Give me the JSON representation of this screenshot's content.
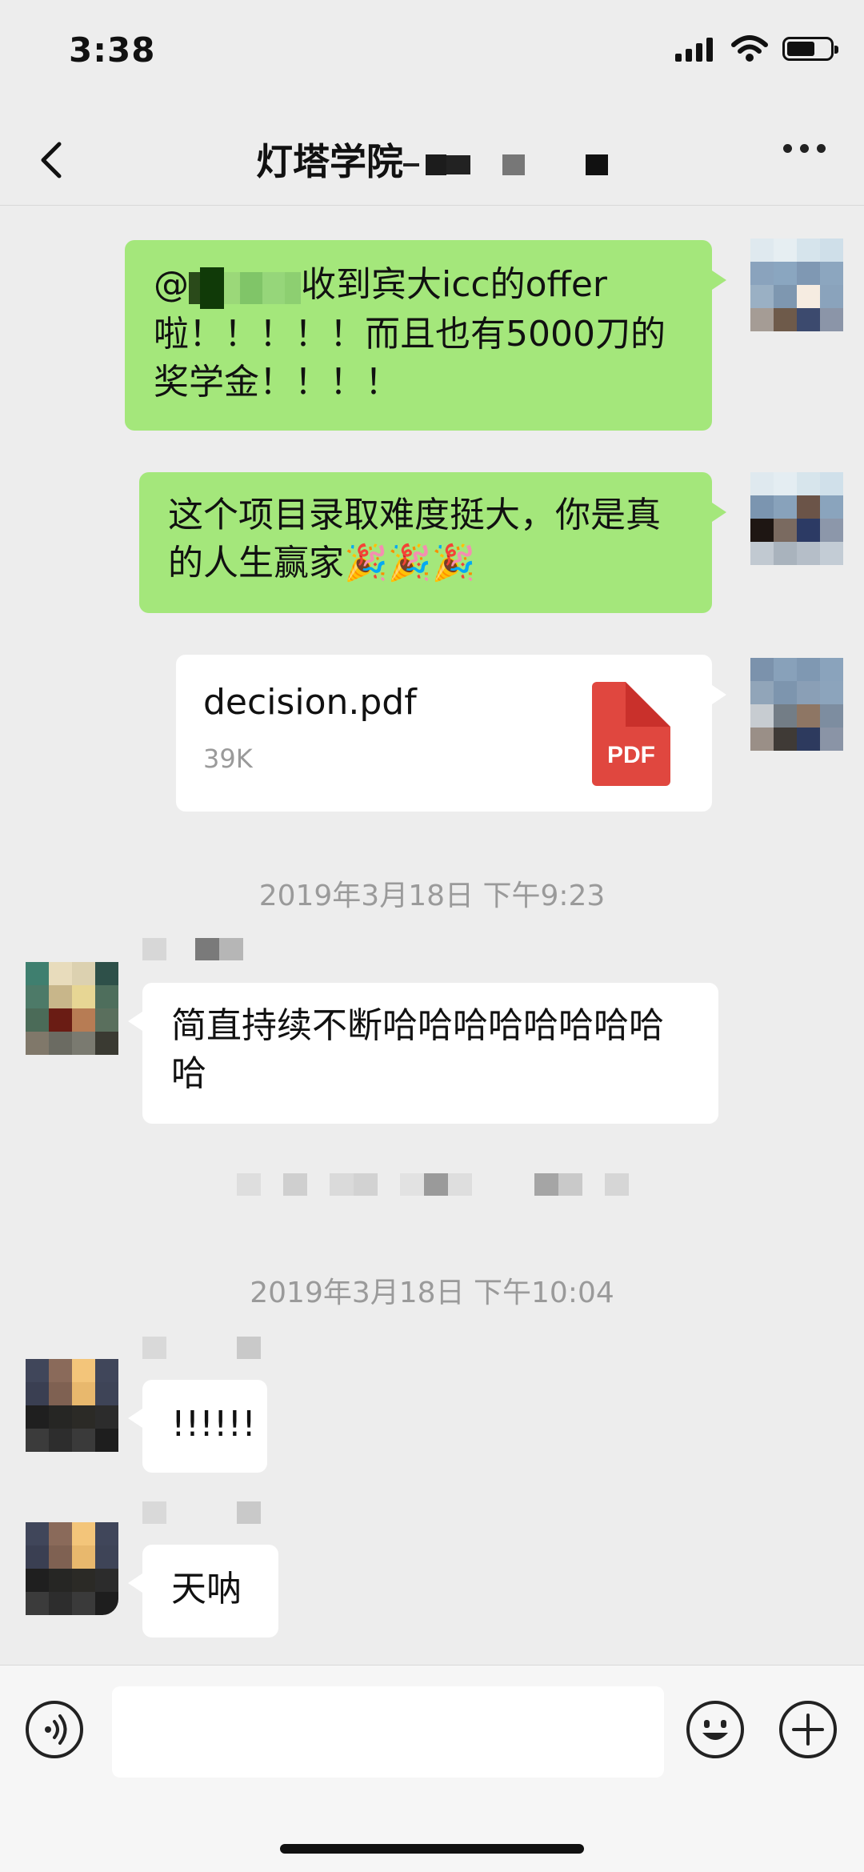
{
  "status_bar": {
    "time": "3:38"
  },
  "header": {
    "title": "灯塔学院"
  },
  "messages": [
    {
      "from": "me",
      "type": "text",
      "prefix": "@",
      "text": "收到宾大icc的offer啦！！！！！而且也有5000刀的奖学金！！！！"
    },
    {
      "from": "me",
      "type": "text",
      "text": "这个项目录取难度挺大，你是真的人生赢家🎉🎉🎉"
    },
    {
      "from": "me",
      "type": "file",
      "file_name": "decision.pdf",
      "file_size": "39K",
      "file_type_label": "PDF"
    },
    {
      "type": "timestamp",
      "text": "2019年3月18日 下午9:23"
    },
    {
      "from": "other",
      "type": "text",
      "text": "简直持续不断哈哈哈哈哈哈哈哈哈"
    },
    {
      "type": "timestamp",
      "text": "2019年3月18日 下午10:04"
    },
    {
      "from": "other",
      "type": "text",
      "text": "!!!!!!"
    },
    {
      "from": "other",
      "type": "text",
      "text": "天呐"
    }
  ],
  "input_bar": {
    "placeholder": ""
  },
  "colors": {
    "sent_bubble": "#a4e77b",
    "received_bubble": "#ffffff",
    "background": "#ededed",
    "pdf_icon": "#e0473f"
  },
  "icons": [
    "back-chevron-icon",
    "more-dots-icon",
    "voice-icon",
    "emoji-icon",
    "add-icon",
    "signal-icon",
    "wifi-icon",
    "battery-icon"
  ]
}
